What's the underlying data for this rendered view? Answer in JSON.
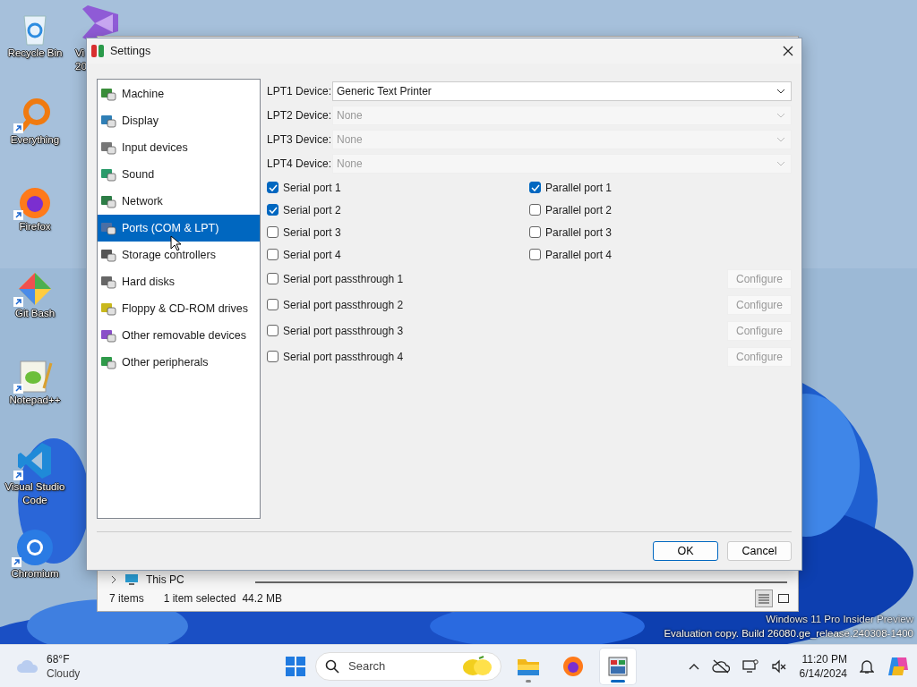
{
  "desktop_icons": [
    {
      "kind": "recycle",
      "lines": [
        "Recycle Bin"
      ],
      "shortcut": false
    },
    {
      "kind": "everything",
      "lines": [
        "Everything"
      ],
      "shortcut": true
    },
    {
      "kind": "firefox",
      "lines": [
        "Firefox"
      ],
      "shortcut": true
    },
    {
      "kind": "gitbash",
      "lines": [
        "Git Bash"
      ],
      "shortcut": true
    },
    {
      "kind": "notepad",
      "lines": [
        "Notepad++"
      ],
      "shortcut": true
    },
    {
      "kind": "vscode",
      "lines": [
        "Visual Studio",
        "Code"
      ],
      "shortcut": true
    },
    {
      "kind": "chromium",
      "lines": [
        "Chromium"
      ],
      "shortcut": true
    }
  ],
  "partial_icon": {
    "lines": [
      "Vi",
      "20"
    ]
  },
  "explorer": {
    "tree_item": "This PC",
    "status": {
      "items": "7 items",
      "selected": "1 item selected",
      "size": "44.2 MB"
    },
    "views": [
      {
        "kind": "details",
        "selected": true
      },
      {
        "kind": "tiles",
        "selected": false
      }
    ]
  },
  "dialog": {
    "title": "Settings",
    "categories": [
      {
        "label": "Machine",
        "selected": false
      },
      {
        "label": "Display",
        "selected": false
      },
      {
        "label": "Input devices",
        "selected": false
      },
      {
        "label": "Sound",
        "selected": false
      },
      {
        "label": "Network",
        "selected": false
      },
      {
        "label": "Ports (COM & LPT)",
        "selected": true
      },
      {
        "label": "Storage controllers",
        "selected": false
      },
      {
        "label": "Hard disks",
        "selected": false
      },
      {
        "label": "Floppy & CD-ROM drives",
        "selected": false
      },
      {
        "label": "Other removable devices",
        "selected": false
      },
      {
        "label": "Other peripherals",
        "selected": false
      }
    ],
    "lpt_devices": [
      {
        "label": "LPT1 Device:",
        "value": "Generic Text Printer",
        "disabled": false
      },
      {
        "label": "LPT2 Device:",
        "value": "None",
        "disabled": true
      },
      {
        "label": "LPT3 Device:",
        "value": "None",
        "disabled": true
      },
      {
        "label": "LPT4 Device:",
        "value": "None",
        "disabled": true
      }
    ],
    "serial_ports": [
      {
        "label": "Serial port 1",
        "checked": true
      },
      {
        "label": "Serial port 2",
        "checked": true
      },
      {
        "label": "Serial port 3",
        "checked": false
      },
      {
        "label": "Serial port 4",
        "checked": false
      }
    ],
    "parallel_ports": [
      {
        "label": "Parallel port 1",
        "checked": true
      },
      {
        "label": "Parallel port 2",
        "checked": false
      },
      {
        "label": "Parallel port 3",
        "checked": false
      },
      {
        "label": "Parallel port 4",
        "checked": false
      }
    ],
    "passthrough": [
      {
        "label": "Serial port passthrough 1",
        "checked": false,
        "button": "Configure",
        "button_disabled": true
      },
      {
        "label": "Serial port passthrough 2",
        "checked": false,
        "button": "Configure",
        "button_disabled": true
      },
      {
        "label": "Serial port passthrough 3",
        "checked": false,
        "button": "Configure",
        "button_disabled": true
      },
      {
        "label": "Serial port passthrough 4",
        "checked": false,
        "button": "Configure",
        "button_disabled": true
      }
    ],
    "buttons": [
      {
        "label": "OK",
        "default": true
      },
      {
        "label": "Cancel",
        "default": false
      }
    ]
  },
  "watermark": [
    "Windows 11 Pro Insider Preview",
    "Evaluation copy. Build 26080.ge_release.240308-1400"
  ],
  "taskbar": {
    "weather": {
      "temperature": "68°F",
      "condition": "Cloudy"
    },
    "search": {
      "placeholder": "Search"
    },
    "apps": [
      {
        "kind": "explorer",
        "active": false,
        "running": true
      },
      {
        "kind": "firefox",
        "active": false,
        "running": false
      },
      {
        "kind": "virtualbox",
        "active": true,
        "running": true
      }
    ],
    "clock": {
      "time": "11:20 PM",
      "date": "6/14/2024"
    }
  }
}
